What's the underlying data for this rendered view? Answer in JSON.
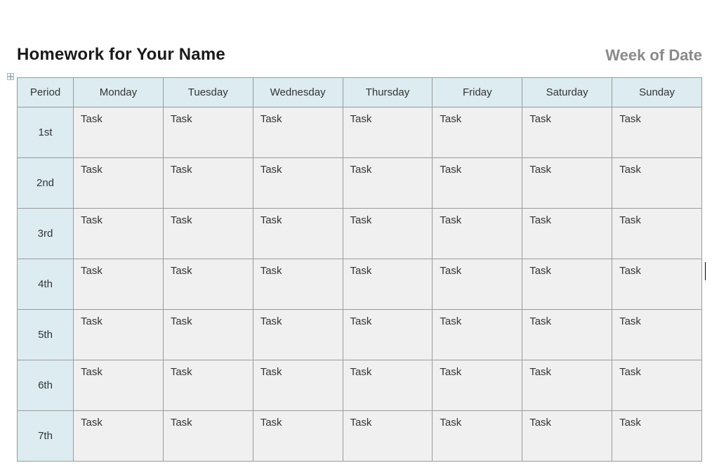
{
  "header": {
    "title": "Homework for Your Name",
    "week": "Week of Date"
  },
  "table": {
    "columns": [
      "Period",
      "Monday",
      "Tuesday",
      "Wednesday",
      "Thursday",
      "Friday",
      "Saturday",
      "Sunday"
    ],
    "rows": [
      {
        "period": "1st",
        "cells": [
          "Task",
          "Task",
          "Task",
          "Task",
          "Task",
          "Task",
          "Task"
        ]
      },
      {
        "period": "2nd",
        "cells": [
          "Task",
          "Task",
          "Task",
          "Task",
          "Task",
          "Task",
          "Task"
        ]
      },
      {
        "period": "3rd",
        "cells": [
          "Task",
          "Task",
          "Task",
          "Task",
          "Task",
          "Task",
          "Task"
        ]
      },
      {
        "period": "4th",
        "cells": [
          "Task",
          "Task",
          "Task",
          "Task",
          "Task",
          "Task",
          "Task"
        ]
      },
      {
        "period": "5th",
        "cells": [
          "Task",
          "Task",
          "Task",
          "Task",
          "Task",
          "Task",
          "Task"
        ]
      },
      {
        "period": "6th",
        "cells": [
          "Task",
          "Task",
          "Task",
          "Task",
          "Task",
          "Task",
          "Task"
        ]
      },
      {
        "period": "7th",
        "cells": [
          "Task",
          "Task",
          "Task",
          "Task",
          "Task",
          "Task",
          "Task"
        ]
      }
    ]
  }
}
